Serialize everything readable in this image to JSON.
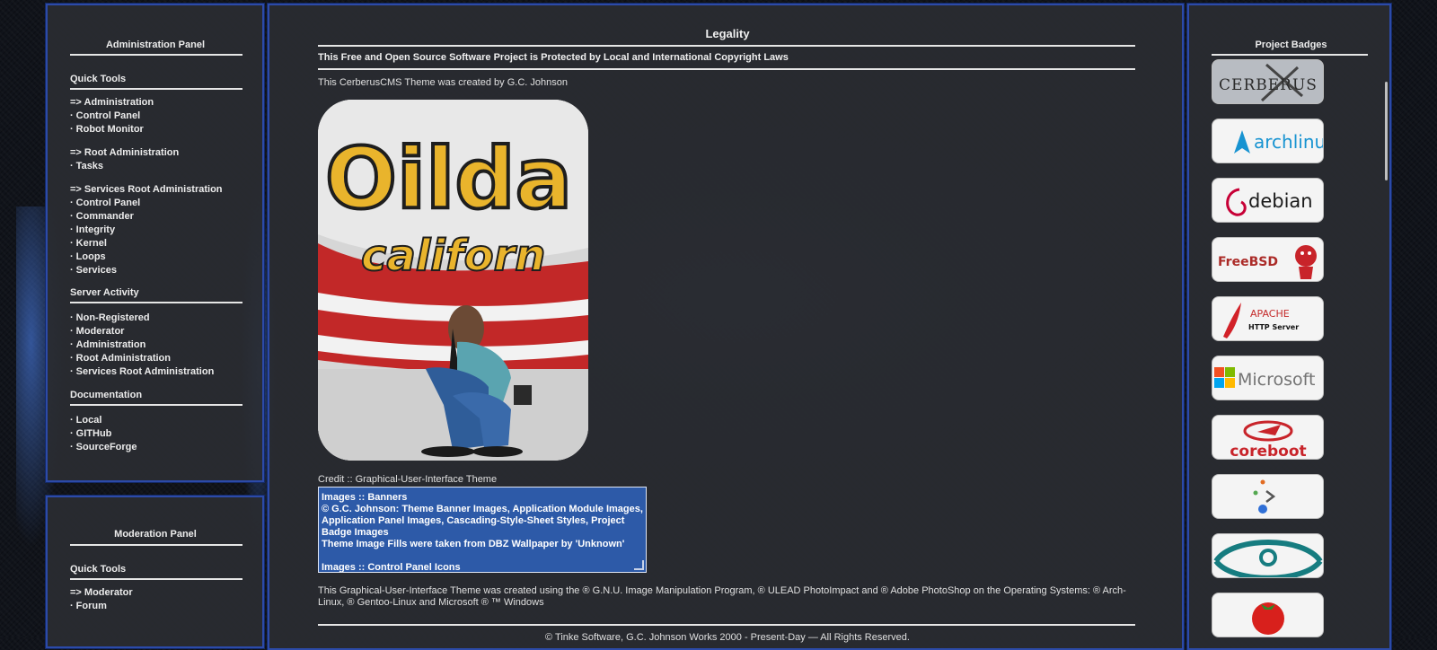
{
  "admin_panel": {
    "title": "Administration Panel",
    "quick_tools": "Quick Tools",
    "admin_heading": "=> Administration",
    "admin_items": [
      "Control Panel",
      "Robot Monitor"
    ],
    "root_heading": "=> Root Administration",
    "root_items": [
      "Tasks"
    ],
    "services_heading": "=> Services Root Administration",
    "services_items": [
      "Control Panel",
      "Commander",
      "Integrity",
      "Kernel",
      "Loops",
      "Services"
    ],
    "server_activity": "Server Activity",
    "server_items": [
      "Non-Registered",
      "Moderator",
      "Administration",
      "Root Administration",
      "Services Root Administration"
    ],
    "documentation": "Documentation",
    "doc_items": [
      "Local",
      "GITHub",
      "SourceForge"
    ]
  },
  "moderation_panel": {
    "title": "Moderation Panel",
    "quick_tools": "Quick Tools",
    "moderator_heading": "=> Moderator",
    "items": [
      "Forum"
    ]
  },
  "bullet": "·",
  "main": {
    "title": "Legality",
    "subtitle": "This Free and Open Source Software Project is Protected by Local and International Copyright Laws",
    "created_by": "This CerberusCMS Theme was created by G.C. Johnson",
    "photo_text": {
      "line1": "Oilda",
      "line2": "californ"
    },
    "credit_label": "Credit :: Graphical-User-Interface Theme",
    "credit_box": [
      "Images :: Banners",
      "© G.C. Johnson: Theme Banner Images, Application Module Images, Application Panel Images, Cascading-Style-Sheet Styles, Project Badge Images",
      "Theme Image Fills were taken from DBZ Wallpaper by 'Unknown'",
      "",
      "Images :: Control Panel Icons"
    ],
    "credit_note": "This Graphical-User-Interface Theme was created using the ® G.N.U. Image Manipulation Program, ® ULEAD PhotoImpact and ® Adobe PhotoShop on the Operating Systems: ® Arch-Linux, ® Gentoo-Linux and Microsoft ® ™ Windows",
    "copyright": "© Tinke Software, G.C. Johnson Works 2000 - Present-Day — All Rights Reserved."
  },
  "badges": {
    "title": "Project Badges",
    "items": [
      {
        "icon": "cerberus-badge",
        "text": "CERBERUS"
      },
      {
        "icon": "archlinux-badge",
        "text": "archlinux"
      },
      {
        "icon": "debian-badge",
        "text": "debian"
      },
      {
        "icon": "freebsd-badge",
        "text": "FreeBSD"
      },
      {
        "icon": "apache-badge",
        "text": "APACHE",
        "subtext": "HTTP Server"
      },
      {
        "icon": "microsoft-badge",
        "text": "Microsoft"
      },
      {
        "icon": "coreboot-badge",
        "text": "coreboot"
      },
      {
        "icon": "gentoo-prompt-badge",
        "text": ""
      },
      {
        "icon": "lineageos-badge",
        "text": ""
      },
      {
        "icon": "tomato-badge",
        "text": ""
      }
    ]
  },
  "colors": {
    "panel_border": "#2c4aa8",
    "credit_box": "#2d5aa8",
    "panel_bg": "#2a2c32"
  }
}
